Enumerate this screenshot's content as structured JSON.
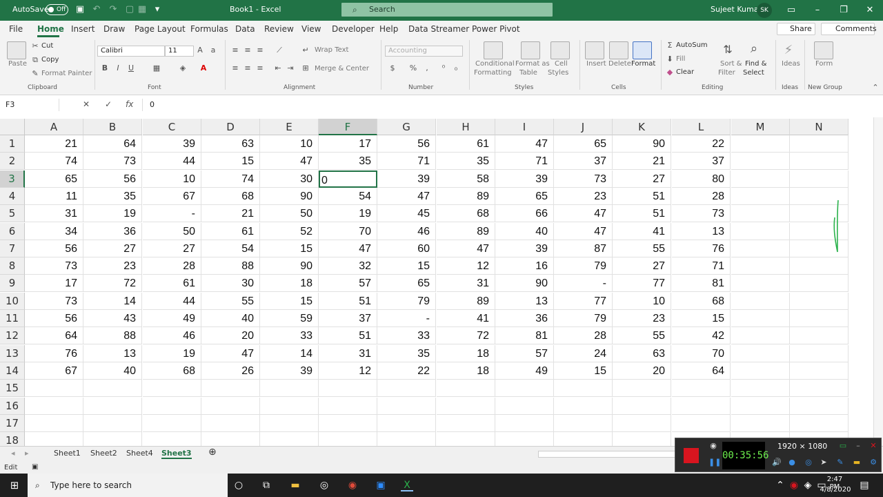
{
  "title_bar": {
    "autosave_label": "AutoSave",
    "autosave_state": "Off",
    "doc_title": "Book1  -  Excel",
    "search_placeholder": "Search",
    "user_name": "Sujeet Kumar",
    "user_initials": "SK"
  },
  "menu": {
    "tabs": [
      "File",
      "Home",
      "Insert",
      "Draw",
      "Page Layout",
      "Formulas",
      "Data",
      "Review",
      "View",
      "Developer",
      "Help",
      "Data Streamer",
      "Power Pivot"
    ],
    "active_tab": "Home",
    "share": "Share",
    "comments": "Comments"
  },
  "ribbon": {
    "clipboard": {
      "paste": "Paste",
      "cut": "Cut",
      "copy": "Copy",
      "format_painter": "Format Painter",
      "group": "Clipboard"
    },
    "font": {
      "name": "Calibri",
      "size": "11",
      "group": "Font"
    },
    "alignment": {
      "wrap_text": "Wrap Text",
      "merge_center": "Merge & Center",
      "group": "Alignment"
    },
    "number": {
      "format": "Accounting",
      "group": "Number"
    },
    "styles": {
      "conditional_1": "Conditional",
      "conditional_2": "Formatting",
      "format_as_table_1": "Format as",
      "format_as_table_2": "Table",
      "cell_styles_1": "Cell",
      "cell_styles_2": "Styles",
      "group": "Styles"
    },
    "cells": {
      "insert": "Insert",
      "delete": "Delete",
      "format": "Format",
      "group": "Cells"
    },
    "editing": {
      "autosum": "AutoSum",
      "fill": "Fill",
      "clear": "Clear",
      "sort_1": "Sort &",
      "sort_2": "Filter",
      "find_1": "Find &",
      "find_2": "Select",
      "group": "Editing"
    },
    "ideas": {
      "label": "Ideas",
      "group": "Ideas"
    },
    "new_group": {
      "form": "Form",
      "group": "New Group"
    }
  },
  "formula_bar": {
    "name_box": "F3",
    "fx": "fx",
    "value": "0"
  },
  "columns": [
    "A",
    "B",
    "C",
    "D",
    "E",
    "F",
    "G",
    "H",
    "I",
    "J",
    "K",
    "L",
    "M",
    "N"
  ],
  "selected_column": "F",
  "rows": [
    {
      "n": "1",
      "cells": [
        "21",
        "64",
        "39",
        "63",
        "10",
        "17",
        "56",
        "61",
        "47",
        "65",
        "90",
        "22"
      ]
    },
    {
      "n": "2",
      "cells": [
        "74",
        "73",
        "44",
        "15",
        "47",
        "35",
        "71",
        "35",
        "71",
        "37",
        "21",
        "37"
      ]
    },
    {
      "n": "3",
      "cells": [
        "65",
        "56",
        "10",
        "74",
        "30",
        "0",
        "39",
        "58",
        "39",
        "73",
        "27",
        "80"
      ]
    },
    {
      "n": "4",
      "cells": [
        "11",
        "35",
        "67",
        "68",
        "90",
        "54",
        "47",
        "89",
        "65",
        "23",
        "51",
        "28"
      ]
    },
    {
      "n": "5",
      "cells": [
        "31",
        "19",
        "-",
        "21",
        "50",
        "19",
        "45",
        "68",
        "66",
        "47",
        "51",
        "73"
      ]
    },
    {
      "n": "6",
      "cells": [
        "34",
        "36",
        "50",
        "61",
        "52",
        "70",
        "46",
        "89",
        "40",
        "47",
        "41",
        "13"
      ]
    },
    {
      "n": "7",
      "cells": [
        "56",
        "27",
        "27",
        "54",
        "15",
        "47",
        "60",
        "47",
        "39",
        "87",
        "55",
        "76"
      ]
    },
    {
      "n": "8",
      "cells": [
        "73",
        "23",
        "28",
        "88",
        "90",
        "32",
        "15",
        "12",
        "16",
        "79",
        "27",
        "71"
      ]
    },
    {
      "n": "9",
      "cells": [
        "17",
        "72",
        "61",
        "30",
        "18",
        "57",
        "65",
        "31",
        "90",
        "-",
        "77",
        "81"
      ]
    },
    {
      "n": "10",
      "cells": [
        "73",
        "14",
        "44",
        "55",
        "15",
        "51",
        "79",
        "89",
        "13",
        "77",
        "10",
        "68"
      ]
    },
    {
      "n": "11",
      "cells": [
        "56",
        "43",
        "49",
        "40",
        "59",
        "37",
        "-",
        "41",
        "36",
        "79",
        "23",
        "15"
      ]
    },
    {
      "n": "12",
      "cells": [
        "64",
        "88",
        "46",
        "20",
        "33",
        "51",
        "33",
        "72",
        "81",
        "28",
        "55",
        "42"
      ]
    },
    {
      "n": "13",
      "cells": [
        "76",
        "13",
        "19",
        "47",
        "14",
        "31",
        "35",
        "18",
        "57",
        "24",
        "63",
        "70"
      ]
    },
    {
      "n": "14",
      "cells": [
        "67",
        "40",
        "68",
        "26",
        "39",
        "12",
        "22",
        "18",
        "49",
        "15",
        "20",
        "64"
      ]
    },
    {
      "n": "15",
      "cells": []
    },
    {
      "n": "16",
      "cells": []
    },
    {
      "n": "17",
      "cells": []
    },
    {
      "n": "18",
      "cells": []
    }
  ],
  "active_cell": {
    "row": 3,
    "col": "F"
  },
  "sheets": [
    "Sheet1",
    "Sheet2",
    "Sheet4",
    "Sheet3"
  ],
  "active_sheet": "Sheet3",
  "status": {
    "mode": "Edit"
  },
  "recorder": {
    "time": "00:35:56",
    "resolution": "1920 × 1080"
  },
  "taskbar": {
    "search_placeholder": "Type here to search",
    "time": "2:47 PM",
    "date": "4/8/2020"
  },
  "colors": {
    "excel_green": "#217346",
    "record_red": "#d8151f"
  }
}
